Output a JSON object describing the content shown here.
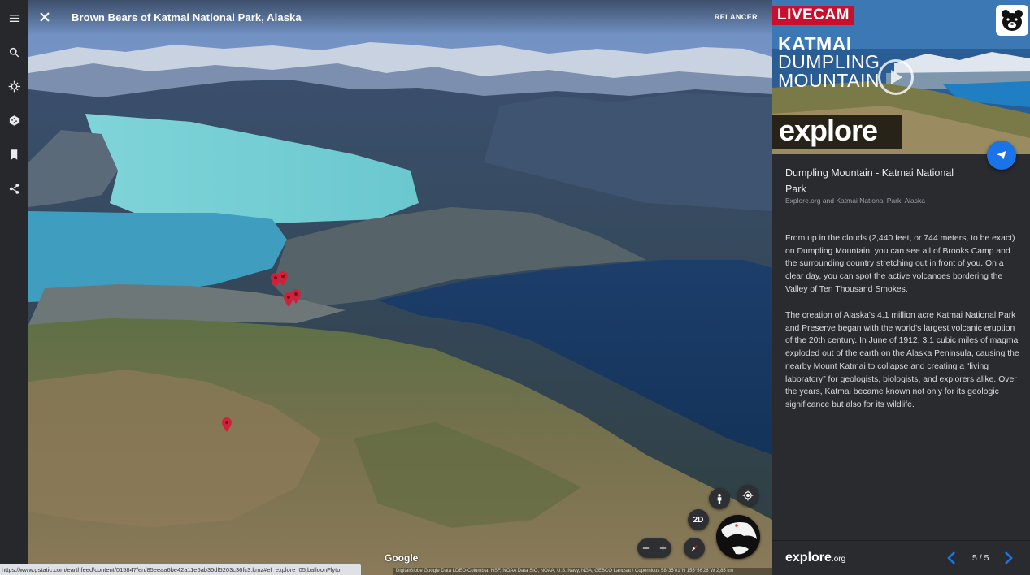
{
  "map": {
    "title": "Brown Bears of Katmai National Park, Alaska",
    "relaunch_label": "RELANCER",
    "google_label": "Google",
    "attribution": "DigitalGlobe   Google   Data LDEO-Columbia, NSF, NOAA   Data SIO, NOAA, U.S. Navy, NGA, GEBCO   Landsat / Copernicus       58°35'01\"N 155°56'26\"W    2,85 km",
    "controls": {
      "mode_2d": "2D",
      "zoom_out": "−",
      "zoom_in": "+"
    }
  },
  "status_url": "https://www.gstatic.com/earthfeed/content/015847/en/85eeaa6be42a11e6ab35df5203c36fc3.kmz#ef_explore_05;balloonFlyto",
  "rail": [
    "menu-icon",
    "search-icon",
    "voyager-icon",
    "dice-icon",
    "bookmark-icon",
    "share-icon"
  ],
  "panel": {
    "hero": {
      "livecam": "LIVECAM",
      "line1": "KATMAI",
      "line2": "DUMPLING",
      "line3": "MOUNTAIN",
      "brand": "explore"
    },
    "title": "Dumpling Mountain - Katmai National Park",
    "subtitle": "Explore.org and Katmai National Park, Alaska",
    "body1": "From up in the clouds (2,440 feet, or 744 meters, to be exact) on Dumpling Mountain, you can see all of Brooks Camp and the surrounding country stretching out in front of you. On a clear day, you can spot the active volcanoes bordering the Valley of Ten Thousand Smokes.",
    "body2": "The creation of Alaska’s 4.1 million acre Katmai National Park and Preserve began with the world’s largest volcanic eruption of the 20th century. In June of 1912, 3.1 cubic miles of magma exploded out of the earth on the Alaska Peninsula, causing the nearby Mount Katmai to collapse and creating a “living laboratory” for geologists, biologists, and explorers alike. Over the years, Katmai became known not only for its geologic significance but also for its wildlife.",
    "footer": {
      "logo": "explore",
      "logo_suffix": ".org",
      "pager": "5 / 5"
    }
  },
  "colors": {
    "accent": "#1a73e8",
    "livecam_red": "#c8102e",
    "pin_red": "#d0213b"
  }
}
